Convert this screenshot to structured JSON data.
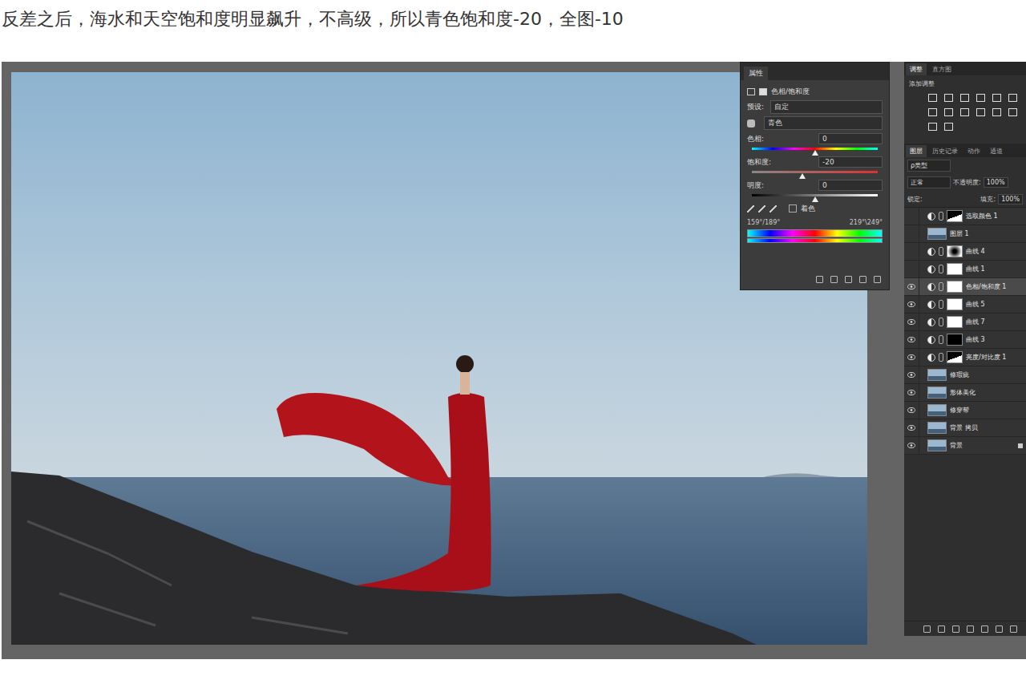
{
  "caption": "反差之后，海水和天空饱和度明显飙升，不高级，所以青色饱和度-20，全图-10",
  "properties": {
    "title": "属性",
    "type_label": "色相/饱和度",
    "preset_label": "预设:",
    "preset": "自定",
    "channel": "青色",
    "sliders": [
      {
        "label": "色相:",
        "value": "0",
        "level": 0.5,
        "kind": "hue"
      },
      {
        "label": "饱和度:",
        "value": "-20",
        "level": 0.4,
        "kind": "saturation"
      },
      {
        "label": "明度:",
        "value": "0",
        "level": 0.5,
        "kind": "lightness"
      }
    ],
    "colorize": {
      "label": "着色",
      "checked": false
    },
    "range_left": "159°/189°",
    "range_right": "219°\\249°"
  },
  "adjustments": {
    "tabs": [
      {
        "label": "调整",
        "selected": true
      },
      {
        "label": "直方图",
        "selected": false
      }
    ],
    "add_label": "添加调整"
  },
  "layers": {
    "tabs": [
      {
        "label": "图层",
        "selected": true
      },
      {
        "label": "历史记录",
        "selected": false
      },
      {
        "label": "动作",
        "selected": false
      },
      {
        "label": "通道",
        "selected": false
      }
    ],
    "filter": "ρ类型",
    "blend": "正常",
    "opacity_label": "不透明度:",
    "opacity": "100%",
    "lock_label": "锁定:",
    "fill_label": "填充:",
    "fill": "100%",
    "items": [
      {
        "name": "选取颜色 1",
        "visible": false,
        "selected": false,
        "kind": "adjustment",
        "mask": "partial"
      },
      {
        "name": "图层 1",
        "visible": false,
        "selected": false,
        "kind": "image",
        "mask": "none"
      },
      {
        "name": "曲线 4",
        "visible": false,
        "selected": false,
        "kind": "adjustment",
        "mask": "gradient"
      },
      {
        "name": "曲线 1",
        "visible": false,
        "selected": false,
        "kind": "adjustment",
        "mask": "white"
      },
      {
        "name": "色相/饱和度 1",
        "visible": true,
        "selected": true,
        "kind": "adjustment",
        "mask": "white"
      },
      {
        "name": "曲线 5",
        "visible": true,
        "selected": false,
        "kind": "adjustment",
        "mask": "white"
      },
      {
        "name": "曲线 7",
        "visible": true,
        "selected": false,
        "kind": "adjustment",
        "mask": "white"
      },
      {
        "name": "曲线 3",
        "visible": true,
        "selected": false,
        "kind": "adjustment",
        "mask": "black"
      },
      {
        "name": "亮度/对比度 1",
        "visible": true,
        "selected": false,
        "kind": "adjustment",
        "mask": "partial"
      },
      {
        "name": "修瑕疵",
        "visible": true,
        "selected": false,
        "kind": "image",
        "mask": "none"
      },
      {
        "name": "形体美化",
        "visible": true,
        "selected": false,
        "kind": "image",
        "mask": "none"
      },
      {
        "name": "修穿帮",
        "visible": true,
        "selected": false,
        "kind": "image",
        "mask": "none"
      },
      {
        "name": "背景 拷贝",
        "visible": true,
        "selected": false,
        "kind": "image",
        "mask": "none"
      },
      {
        "name": "背景",
        "visible": true,
        "selected": false,
        "kind": "image",
        "mask": "none",
        "locked": true
      }
    ]
  }
}
